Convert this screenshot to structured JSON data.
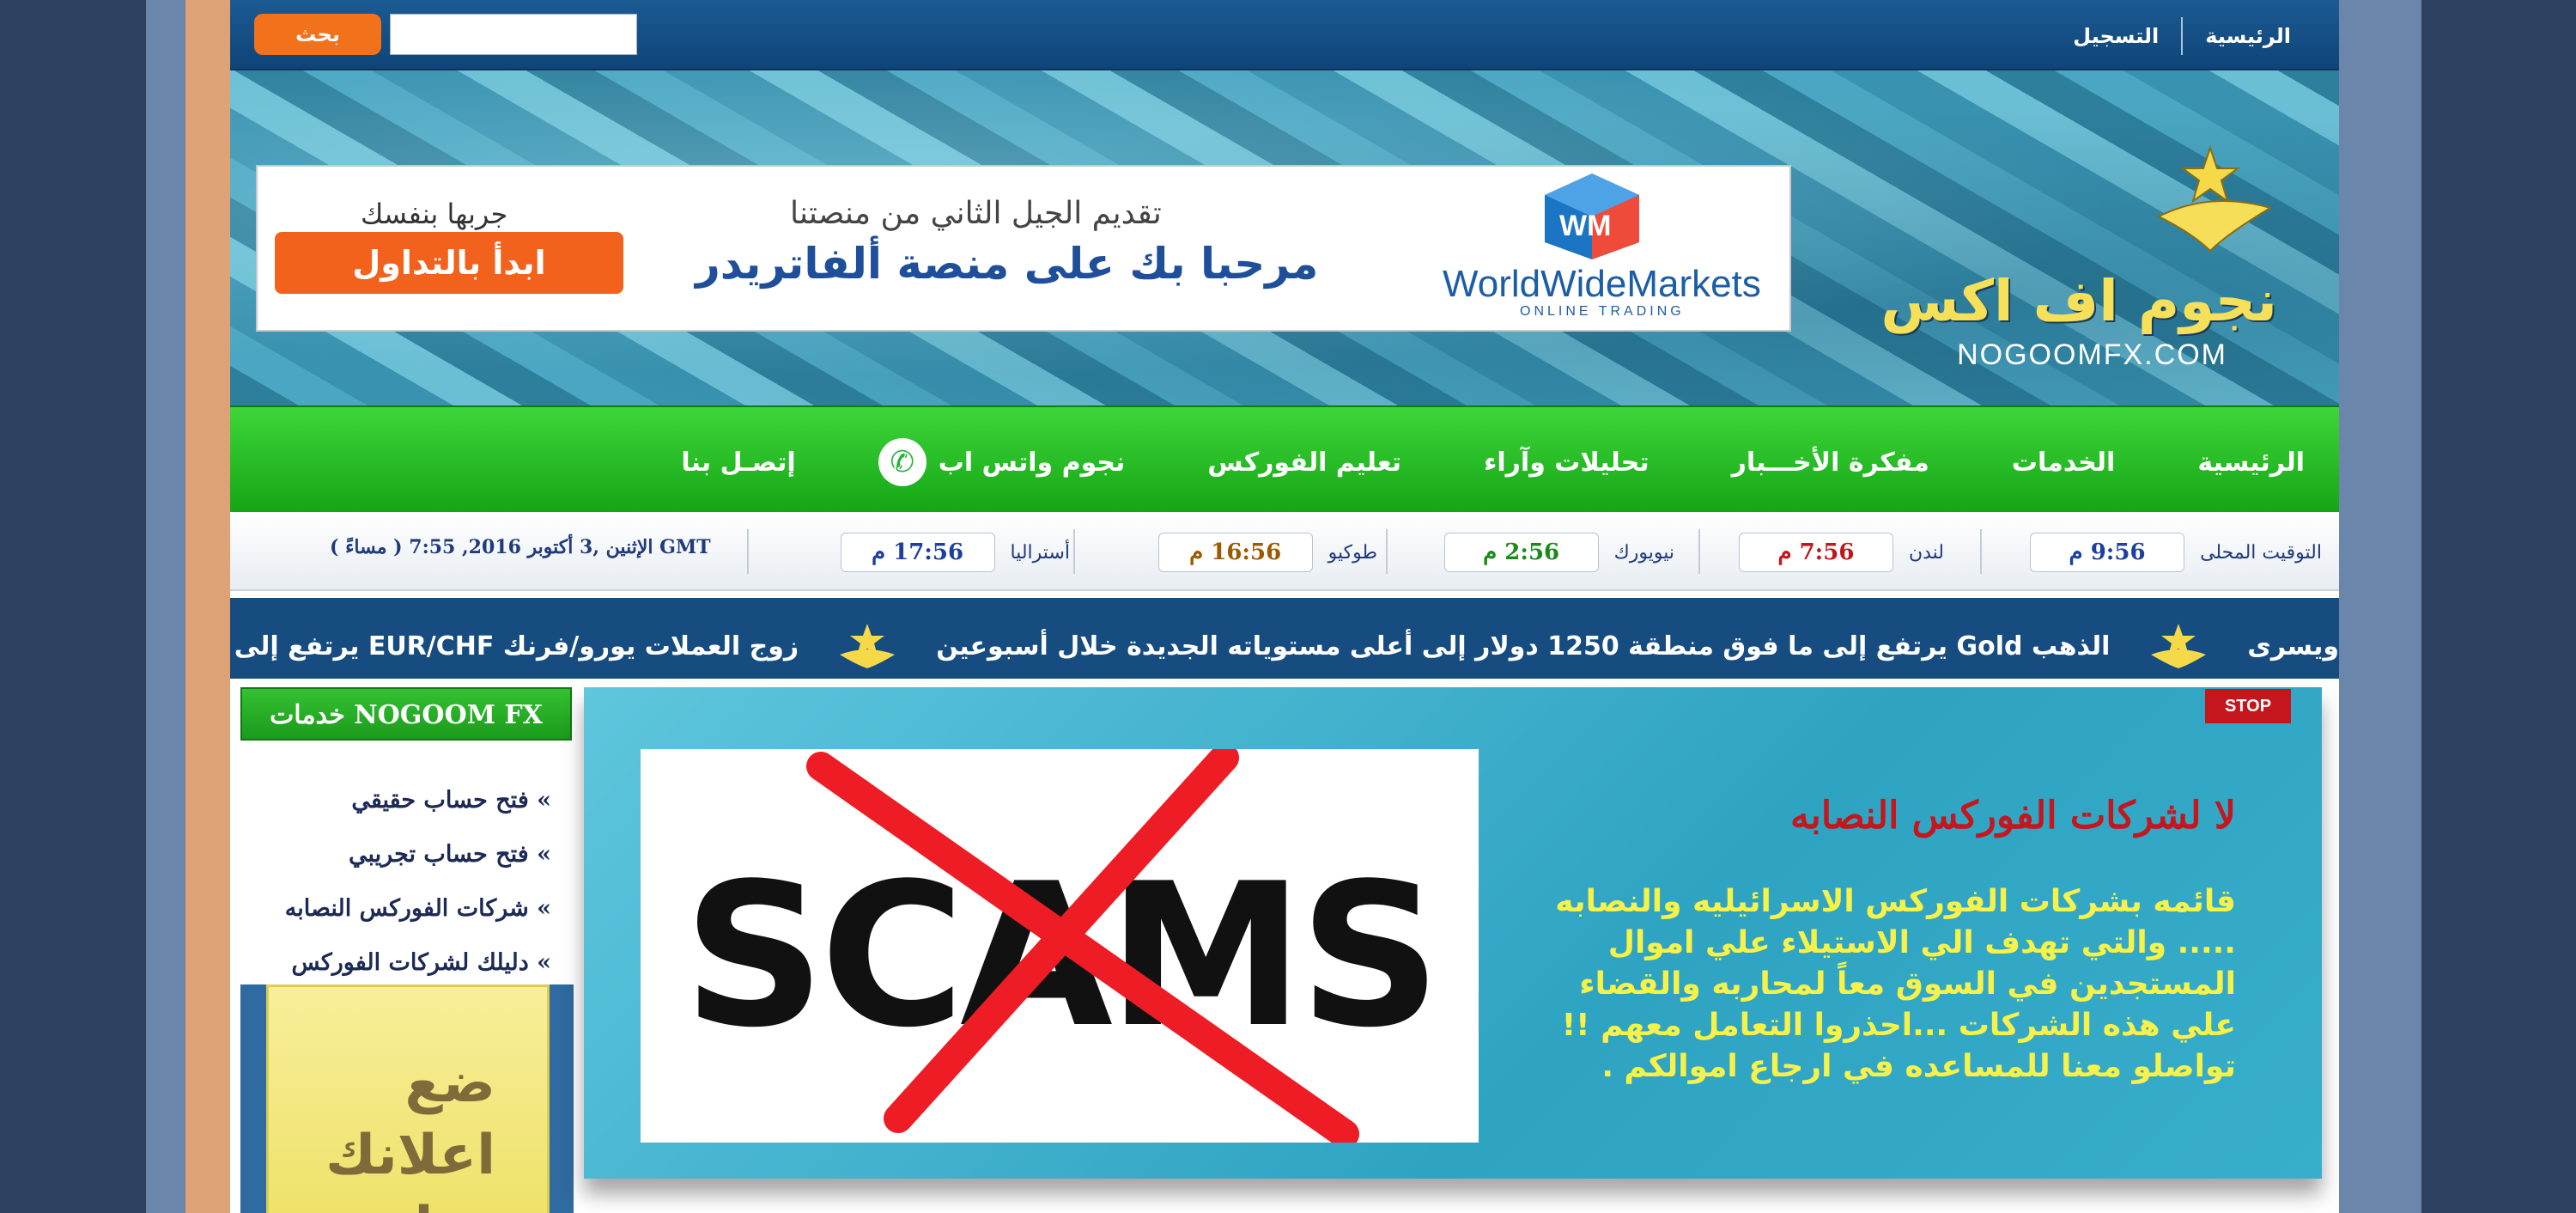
{
  "topbar": {
    "nav": [
      {
        "label": "الرئيسية"
      },
      {
        "label": "التسجيل"
      }
    ],
    "search_button": "بحث",
    "search_value": ""
  },
  "header": {
    "brand_arabic": "نجوم اف اكس",
    "brand_domain": "NOGOOMFX.COM",
    "ad": {
      "slogan": "جربها بنفسك",
      "cta": "ابدأ بالتداول",
      "tagline": "تقديم الجيل الثاني من منصتنا",
      "headline": "مرحبا بك على منصة ألفاتريدر",
      "company": "WorldWideMarkets",
      "company_sub": "ONLINE TRADING"
    }
  },
  "main_nav": [
    {
      "label": "الرئيسية"
    },
    {
      "label": "الخدمات"
    },
    {
      "label": "مفكرة الأخـــبار"
    },
    {
      "label": "تحليلات وآراء"
    },
    {
      "label": "تعليم الفوركس"
    },
    {
      "label": "نجوم واتس اب",
      "icon": "whatsapp-icon"
    },
    {
      "label": "إتصـل بنا"
    }
  ],
  "clocks": {
    "items": [
      {
        "label": "التوقيت المحلى",
        "time": "9:56 م",
        "color": "#1d3f9e"
      },
      {
        "label": "لندن",
        "time": "7:56 م",
        "color": "#c0161c"
      },
      {
        "label": "نيويورك",
        "time": "2:56 م",
        "color": "#1a8a1a"
      },
      {
        "label": "طوكيو",
        "time": "16:56 م",
        "color": "#9a5a00"
      },
      {
        "label": "أستراليا",
        "time": "17:56 م",
        "color": "#1d3f9e"
      }
    ],
    "date_text": "الإثنين ,3 أكتوبر 2016, 7:55 ( مساءً ) GMT"
  },
  "ticker": {
    "items": [
      "ويسرى",
      "الذهب Gold يرتفع إلى ما فوق منطقة 1250 دولار إلى أعلى مستوياته الجديدة خلال أسبوعين",
      "زوج العملات يورو/فرنك EUR/CHF يرتفع إلى قمم الجلسة"
    ]
  },
  "sidebar": {
    "title": "خدمات NOGOOM FX",
    "links": [
      "» فتح حساب حقيقي",
      "» فتح حساب تجريبي",
      "» شركات الفوركس النصابه",
      "» دليلك لشركات الفوركس"
    ],
    "ad_text": "ضع اعلانك هنا"
  },
  "panel": {
    "badge": "STOP",
    "image_word": "SCAMS",
    "title": "لا لشركات الفوركس النصابه",
    "body": "قائمه بشركات الفوركس الاسرائيليه والنصابه ..... والتي تهدف الي الاستيلاء علي اموال المستجدين في السوق معاً لمحاربه والقضاء علي هذه الشركات ...احذروا التعامل معهم !! تواصلو معنا للمساعده في ارجاع اموالكم ."
  },
  "colors": {
    "top_bar": "#1b5b92",
    "nav_green": "#1fae1f",
    "search_orange": "#f2721c",
    "panel_teal": "#3eb3cf",
    "stop_red": "#c4161c",
    "body_yellow": "#f6f24a"
  }
}
